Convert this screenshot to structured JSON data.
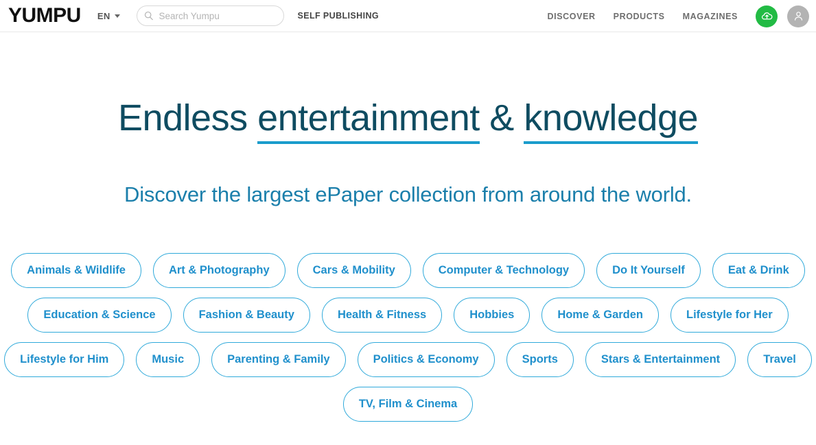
{
  "header": {
    "logo": "YUMPU",
    "language": {
      "label": "EN",
      "icon": "chevron-down-icon"
    },
    "search": {
      "placeholder": "Search Yumpu",
      "value": "",
      "icon": "search-icon"
    },
    "self_publishing": "SELF PUBLISHING",
    "nav": [
      {
        "label": "DISCOVER"
      },
      {
        "label": "PRODUCTS"
      },
      {
        "label": "MAGAZINES"
      }
    ],
    "upload_button": {
      "icon": "cloud-upload-icon",
      "color": "#22bb44"
    },
    "account_button": {
      "icon": "user-avatar-icon",
      "color": "#b3b3b3"
    }
  },
  "hero": {
    "headline": {
      "part1": "Endless ",
      "underlined1": "entertainment",
      "part2": " & ",
      "underlined2": "knowledge"
    },
    "subtitle": "Discover the largest ePaper collection from around the world.",
    "colors": {
      "headline": "#0f4c61",
      "underline": "#1a9ccc",
      "subtitle": "#1b7fab",
      "pill_border": "#2fa9da",
      "pill_text": "#2090cc"
    }
  },
  "categories": {
    "rows": [
      [
        "Animals & Wildlife",
        "Art & Photography",
        "Cars & Mobility",
        "Computer & Technology",
        "Do It Yourself",
        "Eat & Drink"
      ],
      [
        "Education & Science",
        "Fashion & Beauty",
        "Health & Fitness",
        "Hobbies",
        "Home & Garden",
        "Lifestyle for Her"
      ],
      [
        "Lifestyle for Him",
        "Music",
        "Parenting & Family",
        "Politics & Economy",
        "Sports",
        "Stars & Entertainment",
        "Travel"
      ],
      [
        "TV, Film & Cinema"
      ]
    ]
  }
}
